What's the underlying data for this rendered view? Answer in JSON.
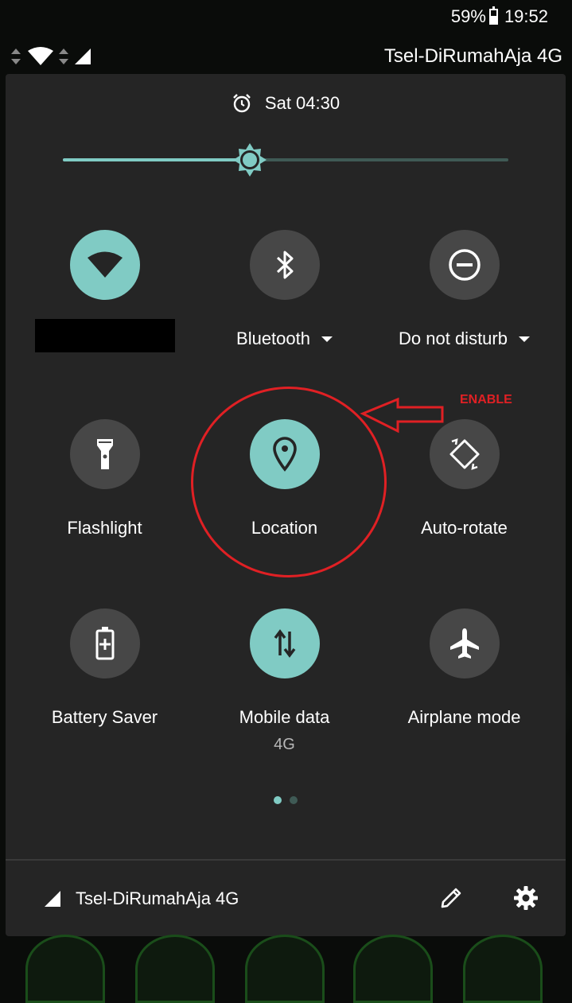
{
  "status_bar": {
    "battery_percent": "59%",
    "battery_level": 0.59,
    "time": "19:52",
    "carrier": "Tsel-DiRumahAja 4G"
  },
  "header": {
    "alarm_icon": "alarm-clock-icon",
    "alarm_text": "Sat 04:30"
  },
  "brightness": {
    "level": 0.42,
    "icon": "brightness-icon"
  },
  "tiles": [
    {
      "id": "wifi",
      "label": "",
      "icon": "wifi-icon",
      "active": true,
      "redacted": true
    },
    {
      "id": "bluetooth",
      "label": "Bluetooth",
      "icon": "bluetooth-icon",
      "active": false,
      "dropdown": true
    },
    {
      "id": "dnd",
      "label": "Do not disturb",
      "icon": "do-not-disturb-icon",
      "active": false,
      "dropdown": true
    },
    {
      "id": "flashlight",
      "label": "Flashlight",
      "icon": "flashlight-icon",
      "active": false
    },
    {
      "id": "location",
      "label": "Location",
      "icon": "location-pin-icon",
      "active": true
    },
    {
      "id": "autorotate",
      "label": "Auto-rotate",
      "icon": "auto-rotate-icon",
      "active": false
    },
    {
      "id": "battery_saver",
      "label": "Battery Saver",
      "icon": "battery-saver-icon",
      "active": false
    },
    {
      "id": "mobile_data",
      "label": "Mobile data",
      "sub": "4G",
      "icon": "mobile-data-icon",
      "active": true
    },
    {
      "id": "airplane",
      "label": "Airplane mode",
      "icon": "airplane-icon",
      "active": false
    }
  ],
  "pager": {
    "pages": 2,
    "current": 1
  },
  "footer": {
    "carrier": "Tsel-DiRumahAja 4G",
    "edit_icon": "pencil-icon",
    "settings_icon": "gear-icon"
  },
  "annotation": {
    "text": "ENABLE",
    "color": "#e02024"
  },
  "colors": {
    "accent": "#80cbc4",
    "tile_off": "#474747",
    "panel": "#252525"
  }
}
